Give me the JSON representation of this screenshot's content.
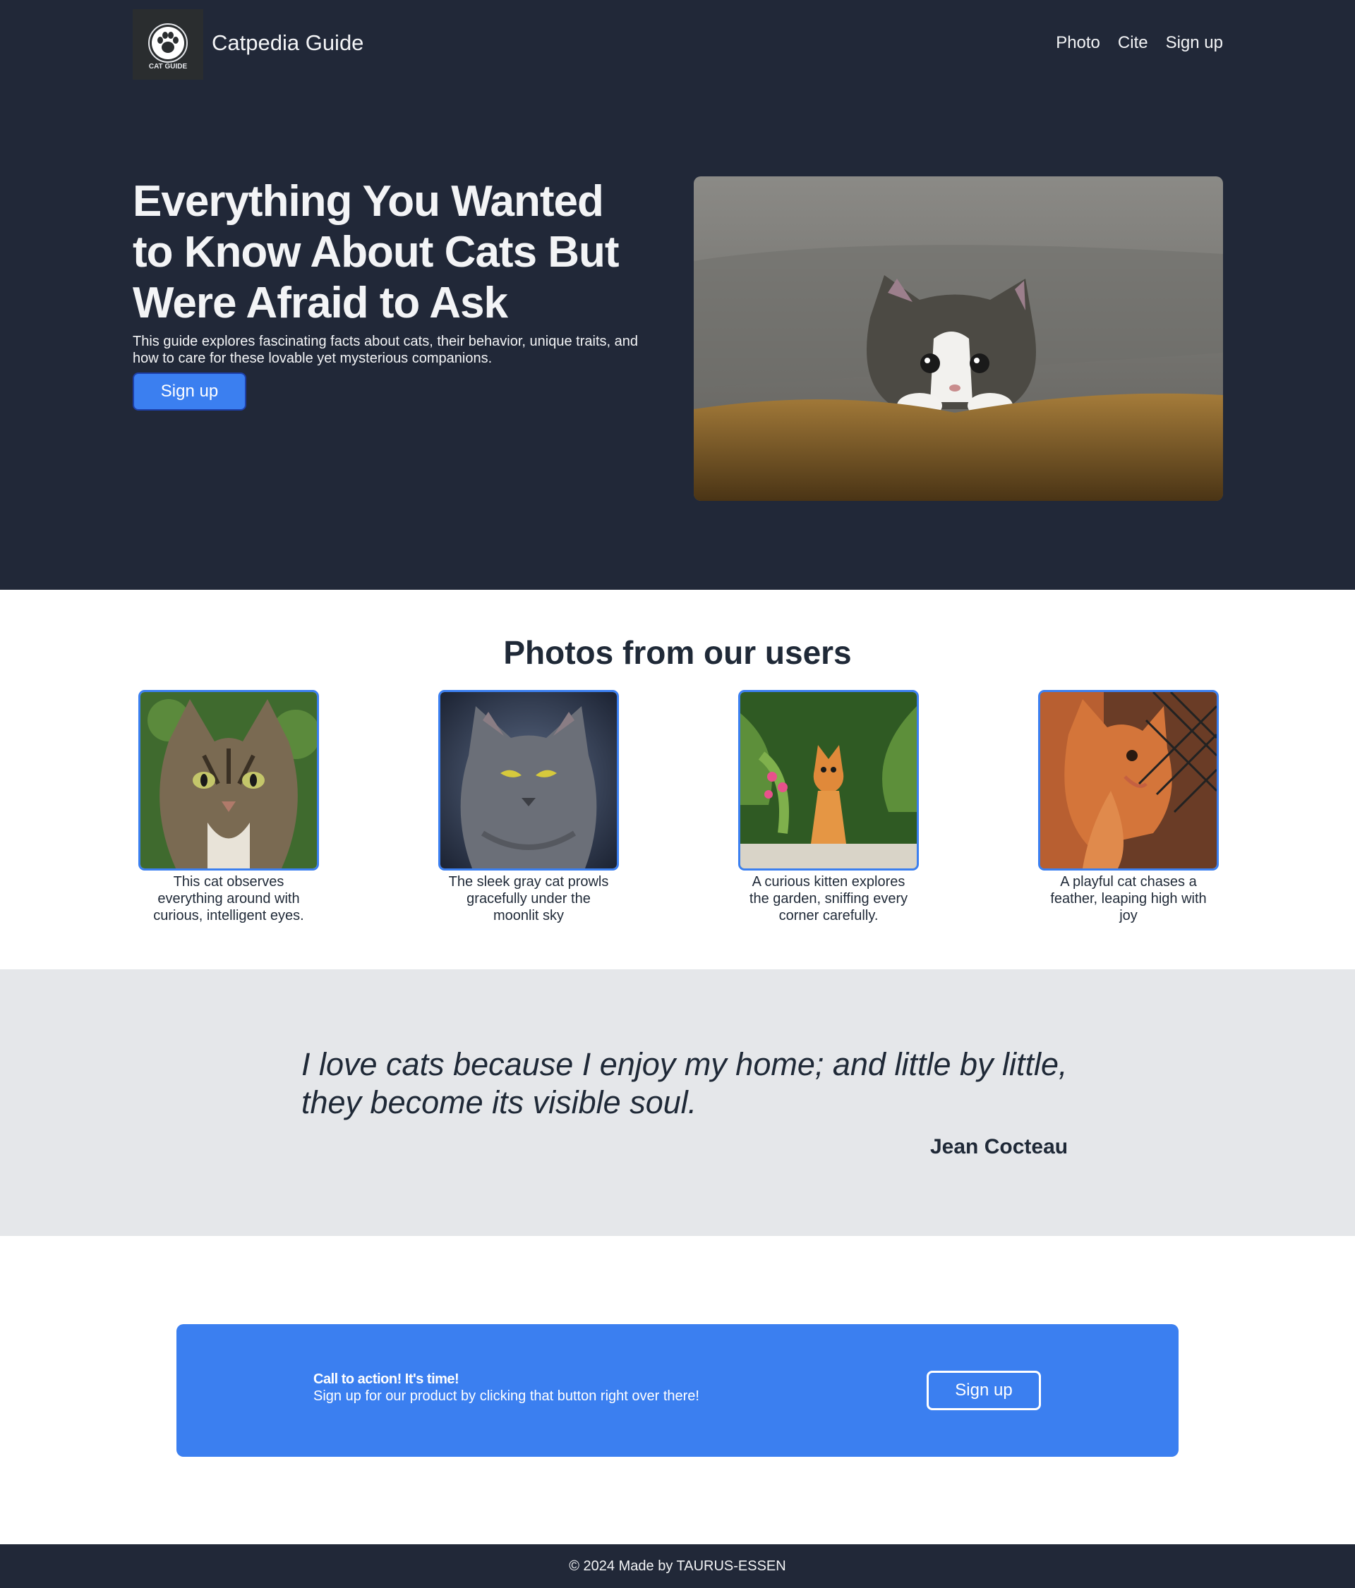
{
  "header": {
    "brand": "Catpedia Guide",
    "logo_text": "CAT GUIDE",
    "nav": [
      "Photo",
      "Cite",
      "Sign up"
    ]
  },
  "hero": {
    "title": "Everything You Wanted to Know About Cats But Were Afraid to Ask",
    "description": "This guide explores fascinating facts about cats, their behavior, unique traits, and how to care for these lovable yet mysterious companions.",
    "button": "Sign up"
  },
  "gallery": {
    "title": "Photos from our users",
    "cards": [
      {
        "caption": "This cat observes everything around with curious, intelligent eyes."
      },
      {
        "caption": "The sleek gray cat prowls gracefully under the moonlit sky"
      },
      {
        "caption": "A curious kitten explores the garden, sniffing every corner carefully."
      },
      {
        "caption": "A playful cat chases a feather, leaping high with joy"
      }
    ]
  },
  "quote": {
    "text": "I love cats because I enjoy my home; and little by little, they become its visible soul.",
    "author": "Jean Cocteau"
  },
  "cta": {
    "title": "Call to action! It's time!",
    "subtitle": "Sign up for our product by clicking that button right over there!",
    "button": "Sign up"
  },
  "footer": {
    "text": "© 2024 Made by TAURUS-ESSEN"
  },
  "colors": {
    "dark_bg": "#212838",
    "accent": "#3b7ff0",
    "quote_bg": "#e5e7ea"
  }
}
